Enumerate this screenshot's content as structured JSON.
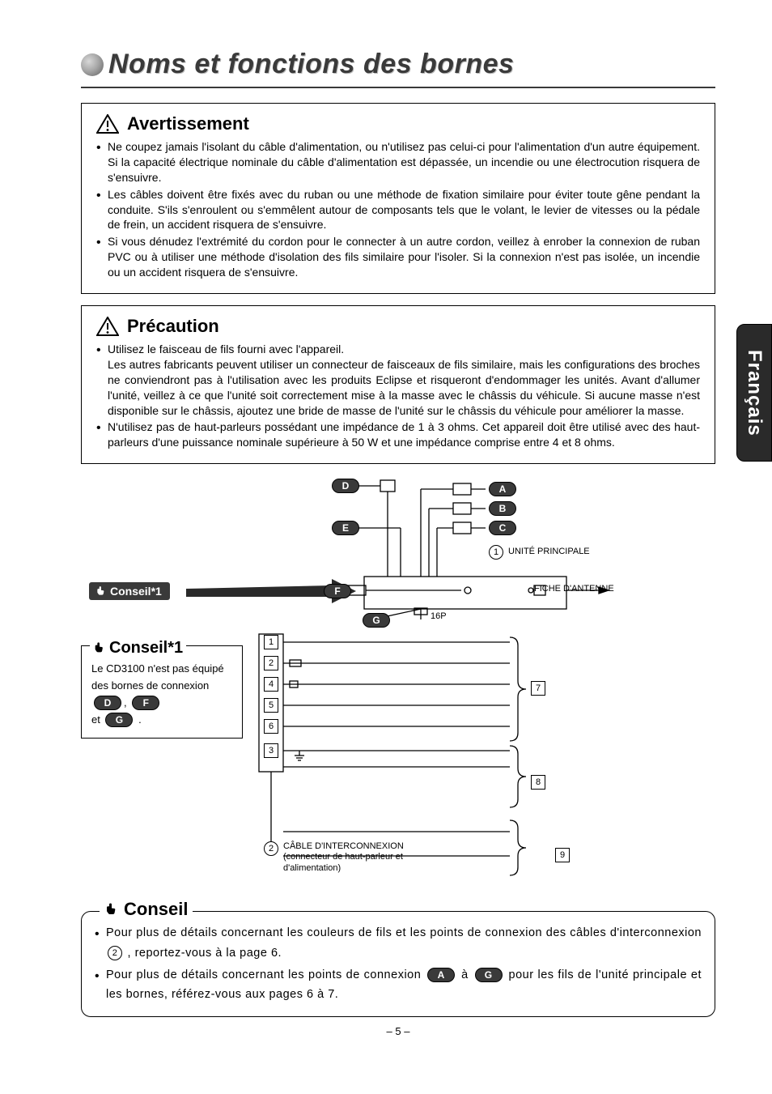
{
  "title": "Noms et fonctions des bornes",
  "side_tab": "Français",
  "warning": {
    "heading": "Avertissement",
    "items": [
      "Ne coupez jamais l'isolant du câble d'alimentation, ou n'utilisez pas celui-ci pour l'alimentation d'un autre équipement. Si la capacité électrique nominale du câble d'alimentation est dépassée, un incendie ou une électrocution risquera de s'ensuivre.",
      "Les câbles doivent être fixés avec du ruban ou une méthode de fixation similaire pour éviter toute gêne pendant la conduite. S'ils s'enroulent ou s'emmêlent autour de composants tels que le volant, le levier de vitesses ou la pédale de frein, un accident risquera de s'ensuivre.",
      "Si vous dénudez l'extrémité du cordon pour le connecter à un autre cordon, veillez à enrober la connexion de ruban PVC ou à utiliser une méthode d'isolation des fils similaire pour l'isoler. Si la connexion n'est pas isolée, un incendie ou un accident risquera de s'ensuivre."
    ]
  },
  "caution": {
    "heading": "Précaution",
    "item1_line1": "Utilisez le faisceau de fils fourni avec l'appareil.",
    "item1_rest": "Les autres fabricants peuvent utiliser un connecteur de faisceaux de fils similaire, mais les configurations des broches ne conviendront pas à l'utilisation avec les produits Eclipse et risqueront d'endommager les unités. Avant d'allumer l'unité, veillez à ce que l'unité soit correctement mise à la masse avec le châssis du véhicule. Si aucune masse n'est disponible sur le châssis, ajoutez une bride de masse de l'unité sur le châssis du véhicule pour améliorer la masse.",
    "item2": "N'utilisez pas de haut-parleurs possédant une impédance de 1 à 3 ohms. Cet appareil doit être utilisé avec des haut-parleurs d'une puissance nominale supérieure à 50 W et une impédance comprise entre 4 et 8 ohms."
  },
  "diagram": {
    "letters": {
      "A": "A",
      "B": "B",
      "C": "C",
      "D": "D",
      "E": "E",
      "F": "F",
      "G": "G"
    },
    "nums": {
      "1": "1",
      "2": "2",
      "3": "3",
      "4": "4",
      "5": "5",
      "6": "6",
      "7": "7",
      "8": "8",
      "9": "9"
    },
    "circled": {
      "1": "1",
      "2": "2"
    },
    "label_unit": "UNITÉ PRINCIPALE",
    "label_antenna": "FICHE D'ANTENNE",
    "label_16p": "16P",
    "label_cable_l1": "CÂBLE D'INTERCONNEXION",
    "label_cable_l2": "(connecteur de haut-parleur et d'alimentation)",
    "conseil_tab": "Conseil*1",
    "note_title": "Conseil*1",
    "note_text_1": "Le CD3100 n'est pas équipé des bornes de connexion ",
    "note_et": "et",
    "note_period": "."
  },
  "conseil_box": {
    "title": "Conseil",
    "b1a": "Pour plus de détails concernant les couleurs de fils et les points de connexion des câbles d'interconnexion ",
    "b1b": ", reportez-vous à la page 6.",
    "b2a": "Pour plus de détails concernant les points de connexion ",
    "b2_mid": " à ",
    "b2b": " pour les fils de l'unité principale et les bornes, référez-vous aux pages 6 à 7."
  },
  "page_number": "– 5 –"
}
